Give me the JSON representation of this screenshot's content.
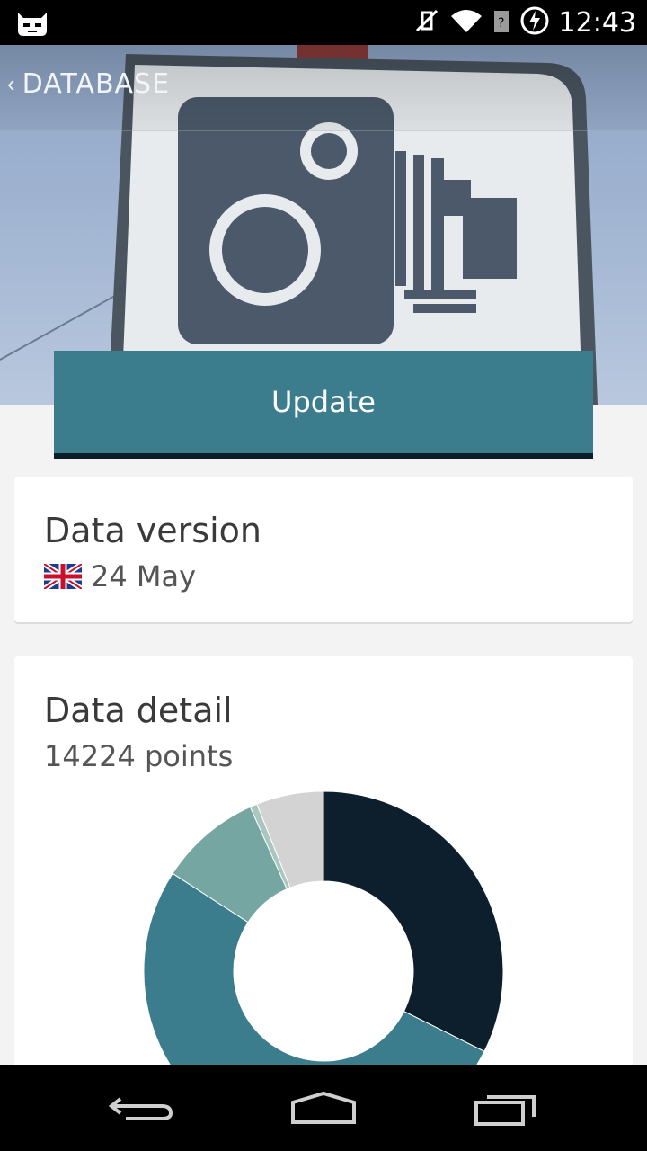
{
  "status_bar": {
    "time": "12:43",
    "icons": [
      "cyanogen-mascot-icon",
      "mute-icon",
      "wifi-icon",
      "no-signal-icon",
      "battery-charging-icon"
    ]
  },
  "header": {
    "title": "DATABASE",
    "back_icon": "back-chevron-icon",
    "background_image": "speed-camera-sign"
  },
  "update_button": {
    "label": "Update",
    "color": "#3b7d8c"
  },
  "data_version": {
    "title": "Data version",
    "flag": "uk-flag-icon",
    "value": "24 May"
  },
  "data_detail": {
    "title": "Data detail",
    "points": "14224 points"
  },
  "chart_data": {
    "type": "pie",
    "title": "",
    "slices": [
      {
        "value": 0.3,
        "color": "#0d1f2c"
      },
      {
        "value": 0.48,
        "color": "#3b7d8c"
      },
      {
        "value": 0.085,
        "color": "#75a6a1"
      },
      {
        "value": 0.006,
        "color": "#a9c7c0"
      },
      {
        "value": 0.056,
        "color": "#d3d3d3"
      }
    ]
  },
  "navbar": {
    "icons": [
      "back-nav-icon",
      "home-nav-icon",
      "recents-nav-icon"
    ]
  }
}
